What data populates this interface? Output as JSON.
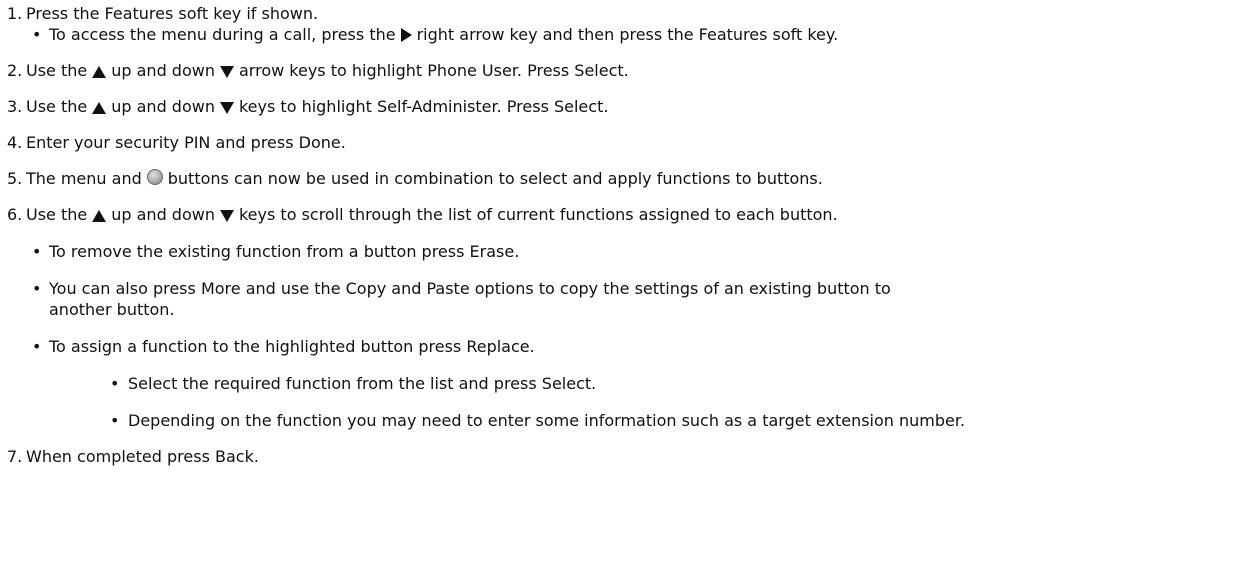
{
  "steps": {
    "s1": {
      "num": "1.",
      "text": "Press the Features soft key if shown."
    },
    "s1b1": {
      "a": "To access the menu during a call, press the",
      "b": "right arrow key and then press the Features soft key."
    },
    "s2": {
      "num": "2.",
      "a": "Use the",
      "b": "up and down",
      "c": "arrow keys to highlight Phone User. Press Select."
    },
    "s3": {
      "num": "3.",
      "a": "Use the",
      "b": "up and down",
      "c": "keys to highlight Self-Administer. Press Select."
    },
    "s4": {
      "num": "4.",
      "text": "Enter your security PIN and press Done."
    },
    "s5": {
      "num": "5.",
      "a": "The menu and",
      "b": "buttons can now be used in combination to select and apply functions to buttons."
    },
    "s6": {
      "num": "6.",
      "a": "Use the",
      "b": "up and down",
      "c": "keys to scroll through the list of current functions assigned to each button."
    },
    "s6b1": "To remove the existing function from a button press Erase.",
    "s6b2": {
      "line1": "You can also press More and use the Copy and Paste options to copy the settings of an existing button to",
      "line2": "another button."
    },
    "s6b3": "To assign a function to the highlighted button press Replace.",
    "s6b3a": "Select the required function from the list and press Select.",
    "s6b3b": "Depending on the function you may need to enter some information such as a target extension number.",
    "s7": {
      "num": "7.",
      "text": "When completed press Back."
    }
  },
  "bullet": "•",
  "icons": {
    "up": "up-arrow-key-icon",
    "down": "down-arrow-key-icon",
    "right": "right-arrow-key-icon",
    "circle": "line-appearance-button-icon"
  }
}
